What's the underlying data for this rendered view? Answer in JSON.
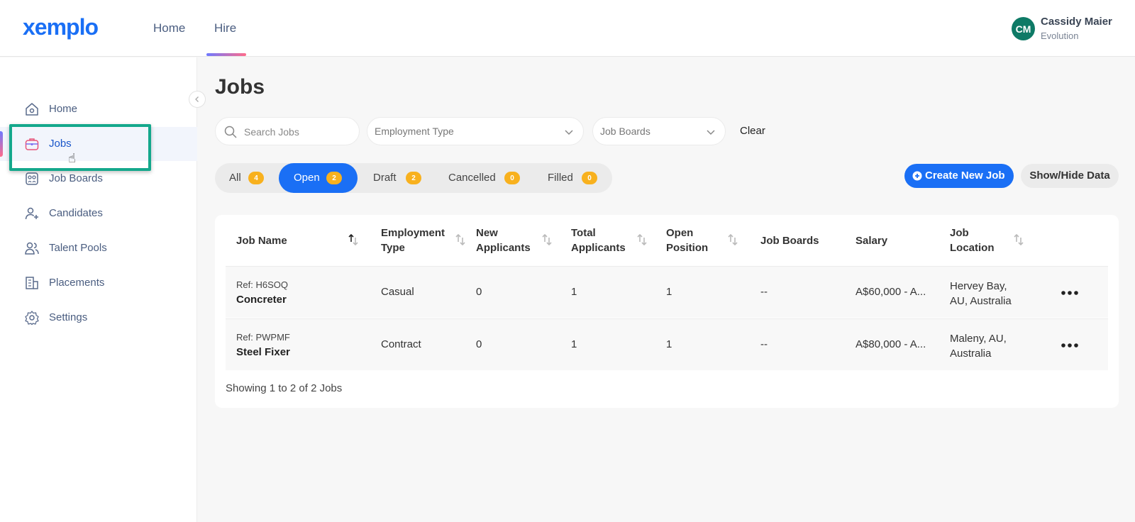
{
  "header": {
    "logo": "xemplo",
    "nav": [
      {
        "label": "Home"
      },
      {
        "label": "Hire"
      }
    ],
    "user": {
      "initials": "CM",
      "name": "Cassidy Maier",
      "org": "Evolution"
    },
    "accent": "#1a6ff5"
  },
  "sidebar": {
    "items": [
      {
        "label": "Home",
        "icon": "home-icon"
      },
      {
        "label": "Jobs",
        "icon": "briefcase-icon",
        "active": true
      },
      {
        "label": "Job Boards",
        "icon": "job-boards-icon"
      },
      {
        "label": "Candidates",
        "icon": "add-user-icon"
      },
      {
        "label": "Talent Pools",
        "icon": "users-icon"
      },
      {
        "label": "Placements",
        "icon": "building-icon"
      },
      {
        "label": "Settings",
        "icon": "gear-icon"
      }
    ],
    "highlight_color": "#14a88c"
  },
  "main": {
    "title": "Jobs",
    "filters": {
      "search_placeholder": "Search Jobs",
      "employment_type": "Employment Type",
      "job_boards": "Job Boards",
      "clear": "Clear"
    },
    "tabs": [
      {
        "label": "All",
        "count": "4"
      },
      {
        "label": "Open",
        "count": "2",
        "active": true
      },
      {
        "label": "Draft",
        "count": "2"
      },
      {
        "label": "Cancelled",
        "count": "0"
      },
      {
        "label": "Filled",
        "count": "0"
      }
    ],
    "actions": {
      "create": "Create New Job",
      "show_hide": "Show/Hide Data"
    },
    "table": {
      "headers": [
        {
          "line1": "Job Name",
          "line2": ""
        },
        {
          "line1": "Employment",
          "line2": "Type"
        },
        {
          "line1": "New",
          "line2": "Applicants"
        },
        {
          "line1": "Total",
          "line2": "Applicants"
        },
        {
          "line1": "Open",
          "line2": "Position"
        },
        {
          "line1": "Job Boards",
          "line2": ""
        },
        {
          "line1": "Salary",
          "line2": ""
        },
        {
          "line1": "Job",
          "line2": "Location"
        }
      ],
      "rows": [
        {
          "ref": "Ref: H6SOQ",
          "name": "Concreter",
          "employment_type": "Casual",
          "new_applicants": "0",
          "total_applicants": "1",
          "open_position": "1",
          "job_boards": "--",
          "salary": "A$60,000 - A...",
          "location_line1": "Hervey Bay,",
          "location_line2": "AU, Australia"
        },
        {
          "ref": "Ref: PWPMF",
          "name": "Steel Fixer",
          "employment_type": "Contract",
          "new_applicants": "0",
          "total_applicants": "1",
          "open_position": "1",
          "job_boards": "--",
          "salary": "A$80,000 - A...",
          "location_line1": "Maleny, AU,",
          "location_line2": "Australia"
        }
      ],
      "footer": "Showing 1 to 2 of 2 Jobs"
    }
  }
}
